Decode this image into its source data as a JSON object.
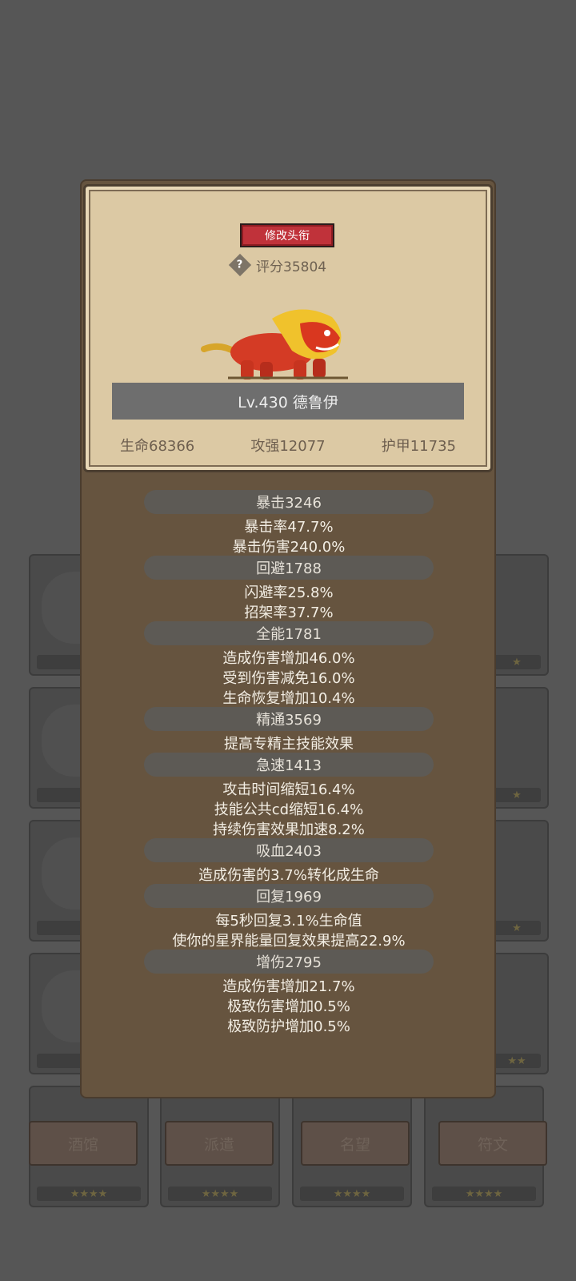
{
  "title_button": "修改头衔",
  "score": "评分35804",
  "character": {
    "level_name": "Lv.430 德鲁伊"
  },
  "base_stats": [
    "生命68366",
    "攻强12077",
    "护甲11735"
  ],
  "attributes": [
    {
      "head": "暴击3246",
      "lines": [
        "暴击率47.7%",
        "暴击伤害240.0%"
      ]
    },
    {
      "head": "回避1788",
      "lines": [
        "闪避率25.8%",
        "招架率37.7%"
      ]
    },
    {
      "head": "全能1781",
      "lines": [
        "造成伤害增加46.0%",
        "受到伤害减免16.0%",
        "生命恢复增加10.4%"
      ]
    },
    {
      "head": "精通3569",
      "lines": [
        "提高专精主技能效果"
      ]
    },
    {
      "head": "急速1413",
      "lines": [
        "攻击时间缩短16.4%",
        "技能公共cd缩短16.4%",
        "持续伤害效果加速8.2%"
      ]
    },
    {
      "head": "吸血2403",
      "lines": [
        "造成伤害的3.7%转化成生命"
      ]
    },
    {
      "head": "回复1969",
      "lines": [
        "每5秒回复3.1%生命值",
        "使你的星界能量回复效果提高22.9%"
      ]
    },
    {
      "head": "增伤2795",
      "lines": [
        "造成伤害增加21.7%",
        "极致伤害增加0.5%",
        "极致防护增加0.5%"
      ]
    }
  ],
  "bottom_tabs": [
    "酒馆",
    "派遣",
    "名望",
    "符文"
  ],
  "colors": {
    "title_button": "#c0323a",
    "parchment": "#dcc9a4",
    "panel": "#66543f"
  }
}
